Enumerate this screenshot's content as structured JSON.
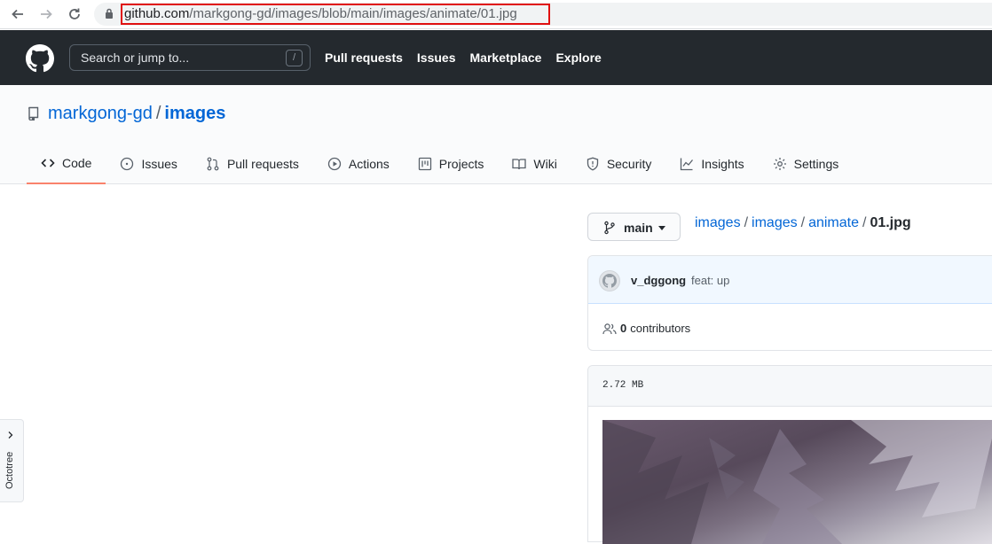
{
  "browser": {
    "url_host": "github.com",
    "url_path": "/markgong-gd/images/blob/main/images/animate/01.jpg",
    "icons": [
      "back-arrow-icon",
      "forward-arrow-icon",
      "reload-icon",
      "lock-icon"
    ]
  },
  "header": {
    "search_placeholder": "Search or jump to...",
    "search_shortcut": "/",
    "nav": [
      "Pull requests",
      "Issues",
      "Marketplace",
      "Explore"
    ]
  },
  "repo": {
    "owner": "markgong-gd",
    "separator": "/",
    "name": "images",
    "tabs": [
      {
        "label": "Code",
        "icon": "code-icon",
        "active": true
      },
      {
        "label": "Issues",
        "icon": "issue-icon"
      },
      {
        "label": "Pull requests",
        "icon": "pull-request-icon"
      },
      {
        "label": "Actions",
        "icon": "play-icon"
      },
      {
        "label": "Projects",
        "icon": "project-icon"
      },
      {
        "label": "Wiki",
        "icon": "book-icon"
      },
      {
        "label": "Security",
        "icon": "shield-icon"
      },
      {
        "label": "Insights",
        "icon": "graph-icon"
      },
      {
        "label": "Settings",
        "icon": "gear-icon"
      }
    ]
  },
  "main": {
    "branch": "main",
    "breadcrumb": [
      "images",
      "images",
      "animate"
    ],
    "breadcrumb_sep": "/",
    "file_name": "01.jpg",
    "commit": {
      "author": "v_dggong",
      "message": "feat: up"
    },
    "contributors_count": "0",
    "contributors_label": "contributors",
    "file_size": "2.72 MB"
  },
  "octotree": {
    "label": "Octotree"
  },
  "colors": {
    "header_bg": "#24292e",
    "link": "#0366d6",
    "active_tab_border": "#f9826c",
    "url_highlight": "#e01010"
  }
}
